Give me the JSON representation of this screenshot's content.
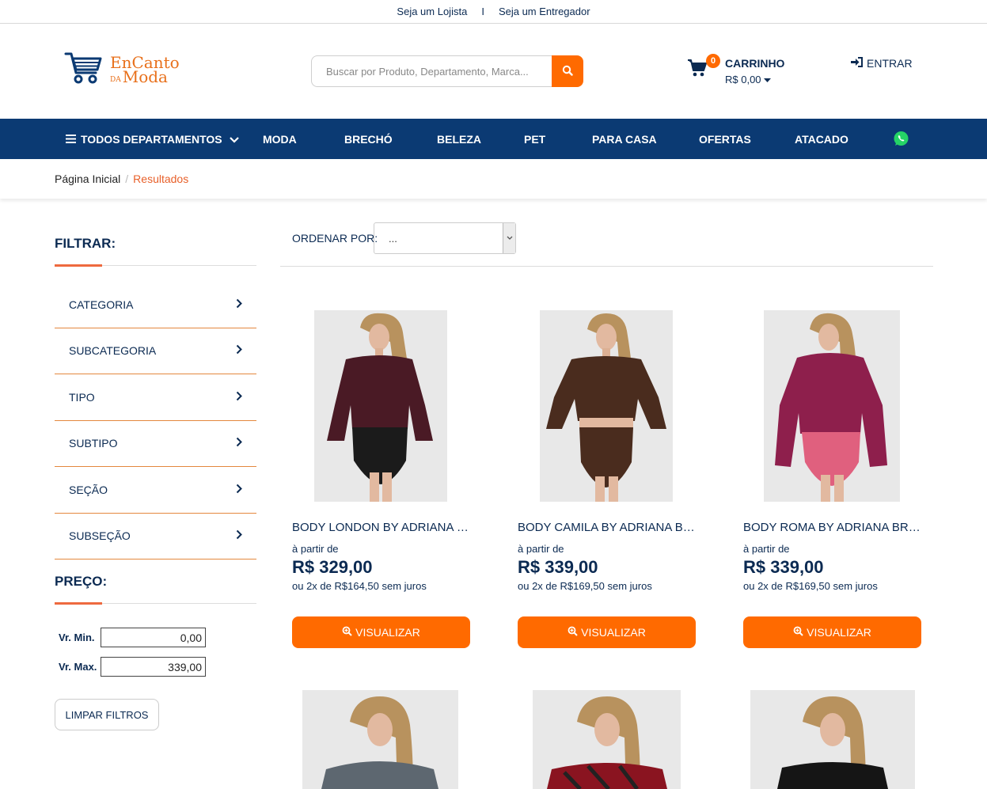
{
  "topbar": {
    "link_lojista": "Seja um Lojista",
    "separator": "I",
    "link_entregador": "Seja um Entregador"
  },
  "logo": {
    "line1": "EnCanto",
    "da": "DA",
    "line2": "Moda",
    "color": "#e8701b"
  },
  "search": {
    "placeholder": "Buscar por Produto, Departamento, Marca..."
  },
  "cart": {
    "count": "0",
    "title": "CARRINHO",
    "value": "R$ 0,00"
  },
  "login": {
    "label": "ENTRAR"
  },
  "nav": {
    "all_departments": "TODOS DEPARTAMENTOS",
    "items": [
      "MODA",
      "BRECHÓ",
      "BELEZA",
      "PET",
      "PARA CASA",
      "OFERTAS",
      "ATACADO"
    ]
  },
  "breadcrumb": {
    "home": "Página Inicial",
    "current": "Resultados"
  },
  "filters": {
    "title": "FILTRAR:",
    "items": [
      "CATEGORIA",
      "SUBCATEGORIA",
      "TIPO",
      "SUBTIPO",
      "SEÇÃO",
      "SUBSEÇÃO"
    ],
    "price_title": "PREÇO:",
    "min_label": "Vr. Min.",
    "min_value": "0,00",
    "max_label": "Vr. Max.",
    "max_value": "339,00",
    "clear_label": "LIMPAR FILTROS"
  },
  "sort": {
    "label": "ORDENAR POR:",
    "value": "..."
  },
  "products": [
    {
      "name": "BODY LONDON BY ADRIANA BRANDÃO",
      "from": "à partir de",
      "price": "R$ 329,00",
      "installments": "ou 2x de R$164,50 sem juros",
      "button": "VISUALIZAR"
    },
    {
      "name": "BODY CAMILA BY ADRIANA BRANDÃO",
      "from": "à partir de",
      "price": "R$ 339,00",
      "installments": "ou 2x de R$169,50 sem juros",
      "button": "VISUALIZAR"
    },
    {
      "name": "BODY ROMA BY ADRIANA BRANDÃO",
      "from": "à partir de",
      "price": "R$ 339,00",
      "installments": "ou 2x de R$169,50 sem juros",
      "button": "VISUALIZAR"
    }
  ],
  "colors": {
    "navy": "#0b3a73",
    "orange": "#ff6a00",
    "accent": "#ee6a3f"
  },
  "icons": [
    "shopping-cart-icon",
    "search-icon",
    "sign-in-icon",
    "bars-icon",
    "chevron-down-icon",
    "whatsapp-icon",
    "chevron-right-icon",
    "zoom-in-icon"
  ]
}
